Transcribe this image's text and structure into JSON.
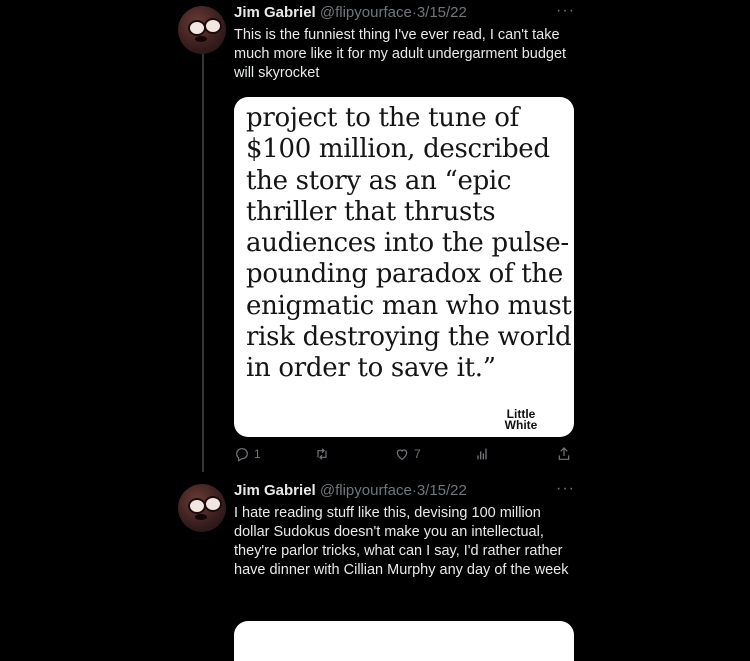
{
  "tweets": [
    {
      "author_name": "Jim Gabriel",
      "handle": "@flipyourface",
      "separator": "·",
      "date": "3/15/22",
      "more": "···",
      "text": "This is the funniest thing I've ever read, I can't take much more like it for my adult undergarment budget will skyrocket",
      "media": {
        "text": "project to the tune of $100 million, described the story as an “epic thriller that thrusts audiences into the pulse-pounding paradox of the enigmatic man who must risk destroying the world in order to save it.”",
        "watermark_line1": "Little",
        "watermark_line2": "White"
      },
      "actions": {
        "reply_count": "1",
        "retweet_count": "",
        "like_count": "7",
        "views_count": ""
      }
    },
    {
      "author_name": "Jim Gabriel",
      "handle": "@flipyourface",
      "separator": "·",
      "date": "3/15/22",
      "more": "···",
      "text": "I hate reading stuff like this, devising 100 million dollar Sudokus doesn't make you an intellectual, they're parlor tricks, what can I say, I'd rather rather have dinner with Cillian Murphy any day of the week"
    }
  ],
  "colors": {
    "background": "#000000",
    "text_primary": "#e7e9ea",
    "text_secondary": "#71767b",
    "thread_line": "#333639"
  },
  "icons": {
    "reply": "reply-icon",
    "retweet": "retweet-icon",
    "like": "like-icon",
    "views": "views-icon",
    "share": "share-icon"
  }
}
